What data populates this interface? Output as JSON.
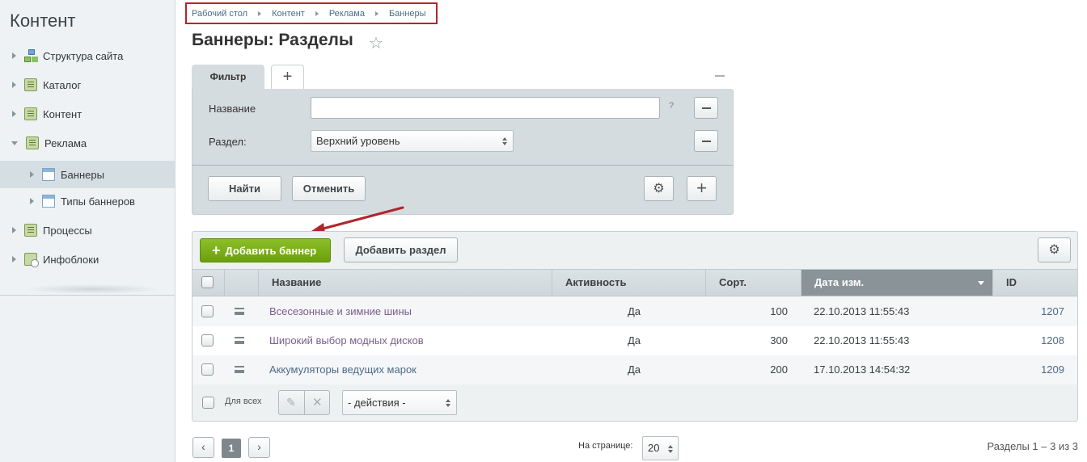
{
  "sidebar": {
    "title": "Контент",
    "items": [
      {
        "label": "Структура сайта",
        "icon": "site-structure-icon"
      },
      {
        "label": "Каталог",
        "icon": "list-icon"
      },
      {
        "label": "Контент",
        "icon": "list-icon"
      },
      {
        "label": "Реклама",
        "icon": "list-icon"
      },
      {
        "label": "Баннеры",
        "icon": "window-icon"
      },
      {
        "label": "Типы баннеров",
        "icon": "window-icon"
      },
      {
        "label": "Процессы",
        "icon": "list-icon"
      },
      {
        "label": "Инфоблоки",
        "icon": "infoblock-icon"
      }
    ]
  },
  "breadcrumb": [
    "Рабочий стол",
    "Контент",
    "Реклама",
    "Баннеры"
  ],
  "page": {
    "title": "Баннеры: Разделы"
  },
  "filter": {
    "tab_label": "Фильтр",
    "add_tab": "+",
    "name_label": "Название",
    "name_value": "",
    "help": "?",
    "section_label": "Раздел:",
    "section_value": "Верхний уровень",
    "find_button": "Найти",
    "cancel_button": "Отменить"
  },
  "toolbar": {
    "add_banner": "Добавить баннер",
    "add_section": "Добавить раздел"
  },
  "table": {
    "headers": {
      "name": "Название",
      "active": "Активность",
      "sort": "Сорт.",
      "date": "Дата изм.",
      "id": "ID"
    },
    "rows": [
      {
        "name": "Всесезонные и зимние шины",
        "active": "Да",
        "sort": "100",
        "date": "22.10.2013 11:55:43",
        "id": "1207"
      },
      {
        "name": "Широкий выбор модных дисков",
        "active": "Да",
        "sort": "300",
        "date": "22.10.2013 11:55:43",
        "id": "1208"
      },
      {
        "name": "Аккумуляторы ведущих марок",
        "active": "Да",
        "sort": "200",
        "date": "17.10.2013 14:54:32",
        "id": "1209"
      }
    ],
    "for_all": "Для всех",
    "actions_value": "- действия -"
  },
  "pager": {
    "prev": "‹",
    "current": "1",
    "next": "›",
    "per_page_label": "На странице:",
    "per_page_value": "20",
    "summary": "Разделы 1 – 3 из 3"
  },
  "colors": {
    "accent_green": "#7aad1a",
    "annotation_red": "#b0262c",
    "link_purple": "#7a5f8a",
    "link_blue": "#4d6b89"
  }
}
